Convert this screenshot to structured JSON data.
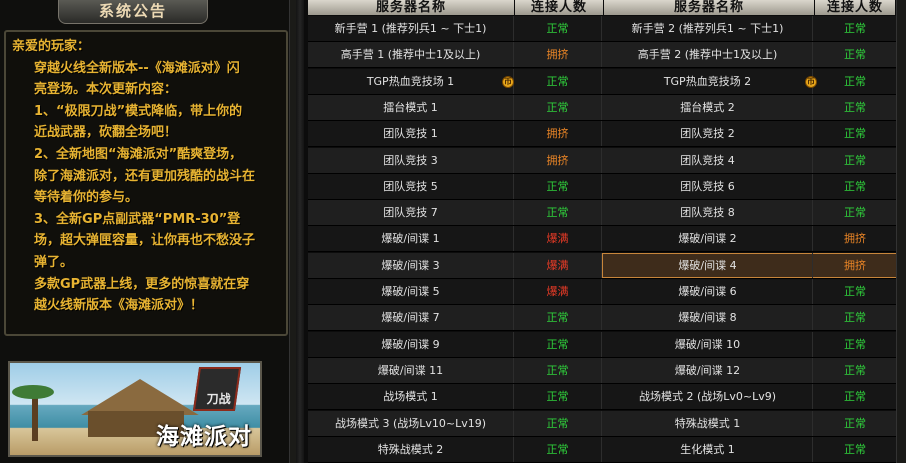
{
  "notice": {
    "title": "系统公告",
    "lines": [
      "亲爱的玩家：",
      "穿越火线全新版本--《海滩派对》闪",
      "亮登场。本次更新内容：",
      "1、“极限刀战”模式降临，带上你的",
      "近战武器，砍翻全场吧！",
      "2、全新地图“海滩派对”酷爽登场，",
      "除了海滩派对，还有更加残酷的战斗在",
      "等待着你的参与。",
      "3、全新GP点副武器“PMR-30”登",
      "场，超大弹匣容量，让你再也不愁没子",
      "弹了。",
      "多款GP武器上线，更多的惊喜就在穿",
      "越火线新版本《海滩派对》！"
    ]
  },
  "banner": {
    "title": "海滩派对",
    "logo": "刀战"
  },
  "table": {
    "headers": [
      "服务器名称",
      "连接人数",
      "服务器名称",
      "连接人数"
    ],
    "coin_icon": "coin-icon",
    "coin_label": "币",
    "status_colors": {
      "正常": "#2fd03b",
      "拥挤": "#e88426",
      "爆满": "#e53a26"
    },
    "rows": [
      {
        "left": "新手营 1 (推荐列兵1 ~ 下士1)",
        "left_status": "正常",
        "right": "新手营 2 (推荐列兵1 ~ 下士1)",
        "right_status": "正常"
      },
      {
        "left": "高手营 1 (推荐中士1及以上)",
        "left_status": "拥挤",
        "right": "高手营 2 (推荐中士1及以上)",
        "right_status": "正常"
      },
      {
        "left": "TGP热血竞技场 1",
        "left_status": "正常",
        "right": "TGP热血竞技场 2",
        "right_status": "正常"
      },
      {
        "left": "擂台模式 1",
        "left_status": "正常",
        "right": "擂台模式 2",
        "right_status": "正常"
      },
      {
        "left": "团队竞技 1",
        "left_status": "拥挤",
        "right": "团队竞技 2",
        "right_status": "正常"
      },
      {
        "left": "团队竞技 3",
        "left_status": "拥挤",
        "right": "团队竞技 4",
        "right_status": "正常"
      },
      {
        "left": "团队竞技 5",
        "left_status": "正常",
        "right": "团队竞技 6",
        "right_status": "正常"
      },
      {
        "left": "团队竞技 7",
        "left_status": "正常",
        "right": "团队竞技 8",
        "right_status": "正常"
      },
      {
        "left": "爆破/间谍 1",
        "left_status": "爆满",
        "right": "爆破/间谍 2",
        "right_status": "拥挤"
      },
      {
        "left": "爆破/间谍 3",
        "left_status": "爆满",
        "right": "爆破/间谍 4",
        "right_status": "拥挤"
      },
      {
        "left": "爆破/间谍 5",
        "left_status": "爆满",
        "right": "爆破/间谍 6",
        "right_status": "正常"
      },
      {
        "left": "爆破/间谍 7",
        "left_status": "正常",
        "right": "爆破/间谍 8",
        "right_status": "正常"
      },
      {
        "left": "爆破/间谍 9",
        "left_status": "正常",
        "right": "爆破/间谍 10",
        "right_status": "正常"
      },
      {
        "left": "爆破/间谍 11",
        "left_status": "正常",
        "right": "爆破/间谍 12",
        "right_status": "正常"
      },
      {
        "left": "战场模式 1",
        "left_status": "正常",
        "right": "战场模式 2 (战场Lv0~Lv9)",
        "right_status": "正常"
      },
      {
        "left": "战场模式 3 (战场Lv10~Lv19)",
        "left_status": "正常",
        "right": "特殊战模式 1",
        "right_status": "正常"
      },
      {
        "left": "特殊战模式 2",
        "left_status": "正常",
        "right": "生化模式 1",
        "right_status": "正常"
      }
    ]
  }
}
